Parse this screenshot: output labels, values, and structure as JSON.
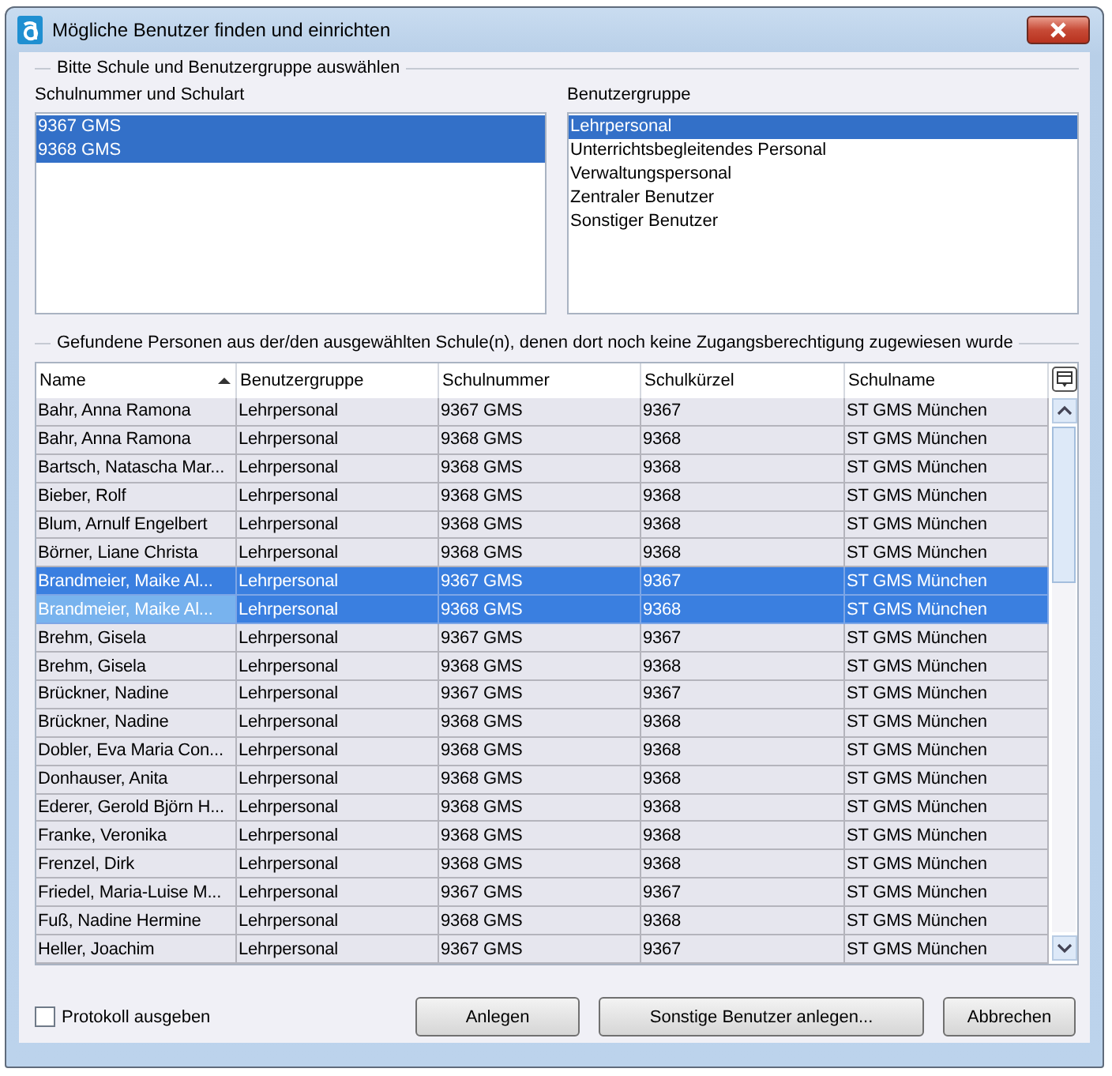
{
  "window": {
    "title": "Mögliche Benutzer finden und einrichten"
  },
  "selection_group": {
    "title": "Bitte Schule und Benutzergruppe auswählen",
    "schools": {
      "label": "Schulnummer und Schulart",
      "items": [
        {
          "label": "9367 GMS",
          "selected": true
        },
        {
          "label": "9368 GMS",
          "selected": true
        }
      ]
    },
    "user_groups": {
      "label": "Benutzergruppe",
      "items": [
        {
          "label": "Lehrpersonal",
          "selected": true
        },
        {
          "label": "Unterrichtsbegleitendes Personal",
          "selected": false
        },
        {
          "label": "Verwaltungspersonal",
          "selected": false
        },
        {
          "label": "Zentraler Benutzer",
          "selected": false
        },
        {
          "label": "Sonstiger Benutzer",
          "selected": false
        }
      ]
    }
  },
  "results_group": {
    "title": "Gefundene Personen aus der/den ausgewählten Schule(n), denen dort noch keine Zugangsberechtigung zugewiesen wurde",
    "table": {
      "columns": [
        {
          "label": "Name",
          "sorted": true
        },
        {
          "label": "Benutzergruppe",
          "sorted": false
        },
        {
          "label": "Schulnummer",
          "sorted": false
        },
        {
          "label": "Schulkürzel",
          "sorted": false
        },
        {
          "label": "Schulname",
          "sorted": false
        }
      ],
      "rows": [
        {
          "cells": [
            "Bahr, Anna Ramona",
            "Lehrpersonal",
            "9367 GMS",
            "9367",
            "ST GMS München"
          ],
          "selected": false,
          "focused": false
        },
        {
          "cells": [
            "Bahr, Anna Ramona",
            "Lehrpersonal",
            "9368 GMS",
            "9368",
            "ST GMS München"
          ],
          "selected": false,
          "focused": false
        },
        {
          "cells": [
            "Bartsch, Natascha Mar...",
            "Lehrpersonal",
            "9368 GMS",
            "9368",
            "ST GMS München"
          ],
          "selected": false,
          "focused": false
        },
        {
          "cells": [
            "Bieber, Rolf",
            "Lehrpersonal",
            "9368 GMS",
            "9368",
            "ST GMS München"
          ],
          "selected": false,
          "focused": false
        },
        {
          "cells": [
            "Blum, Arnulf Engelbert",
            "Lehrpersonal",
            "9368 GMS",
            "9368",
            "ST GMS München"
          ],
          "selected": false,
          "focused": false
        },
        {
          "cells": [
            "Börner, Liane Christa",
            "Lehrpersonal",
            "9368 GMS",
            "9368",
            "ST GMS München"
          ],
          "selected": false,
          "focused": false
        },
        {
          "cells": [
            "Brandmeier, Maike Al...",
            "Lehrpersonal",
            "9367 GMS",
            "9367",
            "ST GMS München"
          ],
          "selected": true,
          "focused": false
        },
        {
          "cells": [
            "Brandmeier, Maike Al...",
            "Lehrpersonal",
            "9368 GMS",
            "9368",
            "ST GMS München"
          ],
          "selected": true,
          "focused": true
        },
        {
          "cells": [
            "Brehm, Gisela",
            "Lehrpersonal",
            "9367 GMS",
            "9367",
            "ST GMS München"
          ],
          "selected": false,
          "focused": false
        },
        {
          "cells": [
            "Brehm, Gisela",
            "Lehrpersonal",
            "9368 GMS",
            "9368",
            "ST GMS München"
          ],
          "selected": false,
          "focused": false
        },
        {
          "cells": [
            "Brückner, Nadine",
            "Lehrpersonal",
            "9367 GMS",
            "9367",
            "ST GMS München"
          ],
          "selected": false,
          "focused": false
        },
        {
          "cells": [
            "Brückner, Nadine",
            "Lehrpersonal",
            "9368 GMS",
            "9368",
            "ST GMS München"
          ],
          "selected": false,
          "focused": false
        },
        {
          "cells": [
            "Dobler, Eva Maria Con...",
            "Lehrpersonal",
            "9368 GMS",
            "9368",
            "ST GMS München"
          ],
          "selected": false,
          "focused": false
        },
        {
          "cells": [
            "Donhauser, Anita",
            "Lehrpersonal",
            "9368 GMS",
            "9368",
            "ST GMS München"
          ],
          "selected": false,
          "focused": false
        },
        {
          "cells": [
            "Ederer, Gerold Björn H...",
            "Lehrpersonal",
            "9368 GMS",
            "9368",
            "ST GMS München"
          ],
          "selected": false,
          "focused": false
        },
        {
          "cells": [
            "Franke, Veronika",
            "Lehrpersonal",
            "9368 GMS",
            "9368",
            "ST GMS München"
          ],
          "selected": false,
          "focused": false
        },
        {
          "cells": [
            "Frenzel, Dirk",
            "Lehrpersonal",
            "9368 GMS",
            "9368",
            "ST GMS München"
          ],
          "selected": false,
          "focused": false
        },
        {
          "cells": [
            "Friedel, Maria-Luise M...",
            "Lehrpersonal",
            "9367 GMS",
            "9367",
            "ST GMS München"
          ],
          "selected": false,
          "focused": false
        },
        {
          "cells": [
            "Fuß, Nadine Hermine",
            "Lehrpersonal",
            "9368 GMS",
            "9368",
            "ST GMS München"
          ],
          "selected": false,
          "focused": false
        },
        {
          "cells": [
            "Heller, Joachim",
            "Lehrpersonal",
            "9367 GMS",
            "9367",
            "ST GMS München"
          ],
          "selected": false,
          "focused": false
        }
      ]
    }
  },
  "footer": {
    "checkbox": {
      "label": "Protokoll ausgeben",
      "checked": false
    },
    "buttons": [
      "Anlegen",
      "Sonstige Benutzer anlegen...",
      "Abbrechen"
    ]
  }
}
